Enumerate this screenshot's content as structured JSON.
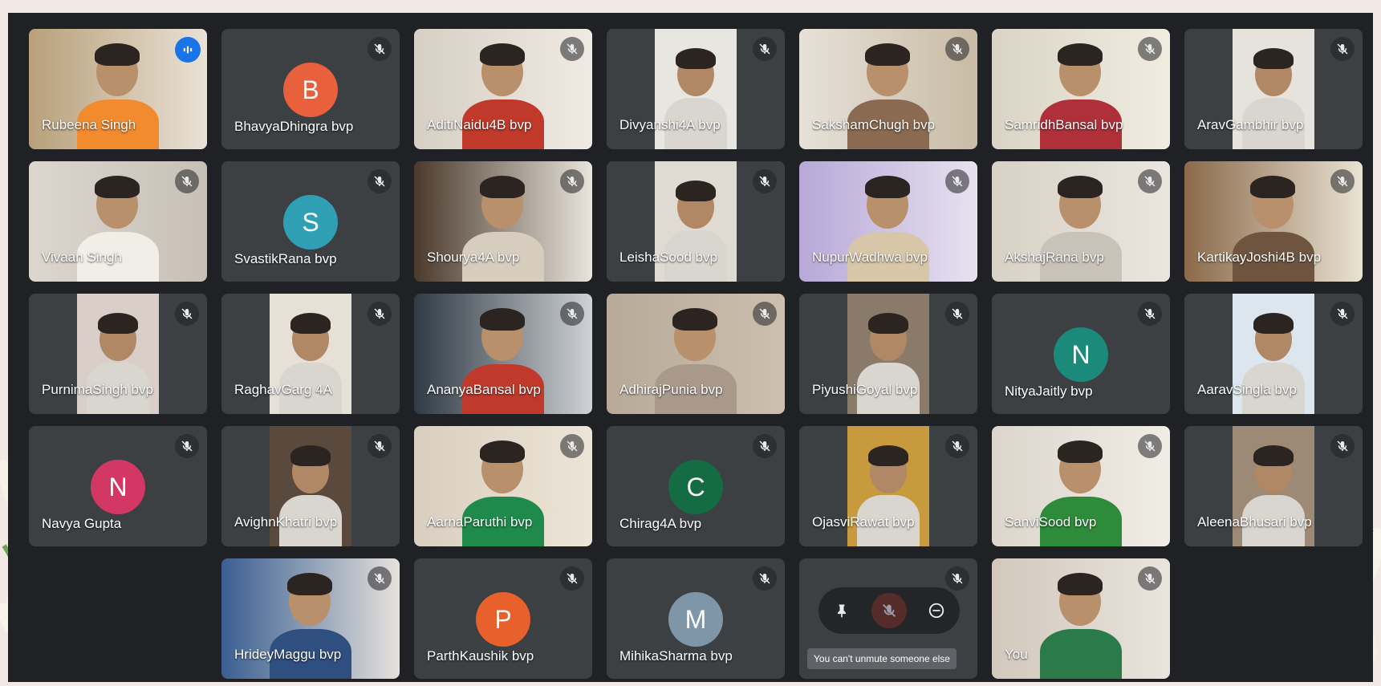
{
  "participants": [
    {
      "name": "Rubeena Singh",
      "avatar_letter": "",
      "avatar_color": "",
      "muted": false,
      "speaking": true,
      "video_colors": [
        "#b8a07a",
        "#e9e2d6",
        "#f28a2e"
      ]
    },
    {
      "name": "BhavyaDhingra bvp",
      "avatar_letter": "B",
      "avatar_color": "#e8603c",
      "muted": true
    },
    {
      "name": "AditiNaidu4B bvp",
      "avatar_letter": "",
      "muted": true,
      "video_colors": [
        "#d6cfc4",
        "#efeae3",
        "#c0392b"
      ]
    },
    {
      "name": "Divyanshi4A bvp",
      "avatar_letter": "",
      "muted": true,
      "video_colors": [
        "#3c4043",
        "#e8e6e1",
        "#3c4043"
      ]
    },
    {
      "name": "SakshamChugh bvp",
      "avatar_letter": "",
      "muted": true,
      "video_colors": [
        "#e6e1d8",
        "#c9bba5",
        "#8a6a50"
      ]
    },
    {
      "name": "SamridhBansal bvp",
      "avatar_letter": "",
      "muted": true,
      "video_colors": [
        "#d9d4c5",
        "#f0ece0",
        "#b0303a"
      ]
    },
    {
      "name": "AravGambhir bvp",
      "avatar_letter": "",
      "muted": true,
      "video_colors": [
        "#3c4043",
        "#e6e2dc",
        "#3c4043"
      ]
    },
    {
      "name": "Vivaan Singh",
      "avatar_letter": "",
      "muted": true,
      "video_colors": [
        "#dcd6cf",
        "#c7c0b6",
        "#f1eee8"
      ]
    },
    {
      "name": "SvastikRana bvp",
      "avatar_letter": "S",
      "avatar_color": "#2fa0b4",
      "muted": true
    },
    {
      "name": "Shourya4A bvp",
      "avatar_letter": "",
      "muted": true,
      "video_colors": [
        "#4a3a2c",
        "#e9e4dc",
        "#d7cdbf"
      ]
    },
    {
      "name": "LeishaSood bvp",
      "avatar_letter": "",
      "muted": true,
      "video_colors": [
        "#3c4043",
        "#e0dbd2",
        "#3c4043"
      ]
    },
    {
      "name": "NupurWadhwa bvp",
      "avatar_letter": "",
      "muted": true,
      "video_colors": [
        "#b7a8d8",
        "#e7e1ef",
        "#d8c6a8"
      ]
    },
    {
      "name": "AkshajRana bvp",
      "avatar_letter": "",
      "muted": true,
      "video_colors": [
        "#d8d1c5",
        "#eae6df",
        "#c9c2b8"
      ]
    },
    {
      "name": "KartikayJoshi4B bvp",
      "avatar_letter": "",
      "muted": true,
      "video_colors": [
        "#8b6a4a",
        "#e9e2d3",
        "#6f5540"
      ]
    },
    {
      "name": "PurnimaSingh bvp",
      "avatar_letter": "",
      "muted": true,
      "video_colors": [
        "#3c4043",
        "#d9cfc8",
        "#3c4043"
      ]
    },
    {
      "name": "RaghavGarg 4A",
      "avatar_letter": "",
      "muted": true,
      "video_colors": [
        "#3c4043",
        "#e6e0d7",
        "#3c4043"
      ]
    },
    {
      "name": "AnanyaBansal bvp",
      "avatar_letter": "",
      "muted": true,
      "video_colors": [
        "#2f3a44",
        "#cfd2d6",
        "#c0392b"
      ]
    },
    {
      "name": "AdhirajPunia bvp",
      "avatar_letter": "",
      "muted": true,
      "video_colors": [
        "#b8aa98",
        "#cdbfae",
        "#a8998a"
      ]
    },
    {
      "name": "PiyushiGoyal bvp",
      "avatar_letter": "",
      "muted": true,
      "video_colors": [
        "#3c4043",
        "#8a7a6a",
        "#3c4043"
      ]
    },
    {
      "name": "NityaJaitly bvp",
      "avatar_letter": "N",
      "avatar_color": "#1b8a7a",
      "muted": true
    },
    {
      "name": "AaravSingla bvp",
      "avatar_letter": "",
      "muted": true,
      "video_colors": [
        "#3c4043",
        "#dce6ee",
        "#3c4043"
      ]
    },
    {
      "name": "Navya Gupta",
      "avatar_letter": "N",
      "avatar_color": "#d33864",
      "muted": true
    },
    {
      "name": "AvighnKhatri bvp",
      "avatar_letter": "",
      "muted": true,
      "video_colors": [
        "#3c4043",
        "#5a4a3e",
        "#3c4043"
      ]
    },
    {
      "name": "AarnaParuthi bvp",
      "avatar_letter": "",
      "muted": true,
      "video_colors": [
        "#d9cfc0",
        "#ece4d6",
        "#1f8a4c"
      ]
    },
    {
      "name": "Chirag4A bvp",
      "avatar_letter": "C",
      "avatar_color": "#146c43",
      "muted": true
    },
    {
      "name": "OjasviRawat bvp",
      "avatar_letter": "",
      "muted": true,
      "video_colors": [
        "#3c4043",
        "#c79a3e",
        "#3c4043"
      ]
    },
    {
      "name": "SanviSood bvp",
      "avatar_letter": "",
      "muted": true,
      "video_colors": [
        "#dcd6cc",
        "#f0ede6",
        "#2e8b3a"
      ]
    },
    {
      "name": "AleenaBhusari bvp",
      "avatar_letter": "",
      "muted": true,
      "video_colors": [
        "#3c4043",
        "#9c8a76",
        "#3c4043"
      ]
    },
    {
      "name": "HrideyMaggu bvp",
      "avatar_letter": "",
      "muted": true,
      "video_colors": [
        "#3a5e92",
        "#e6e2dc",
        "#2f4f80"
      ]
    },
    {
      "name": "ParthKaushik bvp",
      "avatar_letter": "P",
      "avatar_color": "#e8602c",
      "muted": true
    },
    {
      "name": "MihikaSharma bvp",
      "avatar_letter": "M",
      "avatar_color": "#7e96a8",
      "muted": true
    },
    {
      "name": "",
      "avatar_letter": "",
      "muted": true,
      "hovered": true
    },
    {
      "name": "You",
      "avatar_letter": "",
      "muted": true,
      "video_colors": [
        "#d2c8bc",
        "#e9e4dd",
        "#2a7a4a"
      ]
    }
  ],
  "tooltip": "You can't unmute someone else",
  "colors": {
    "meet_bg": "#202124",
    "tile_bg": "#3c4043",
    "active_border": "#8ab4f8"
  }
}
